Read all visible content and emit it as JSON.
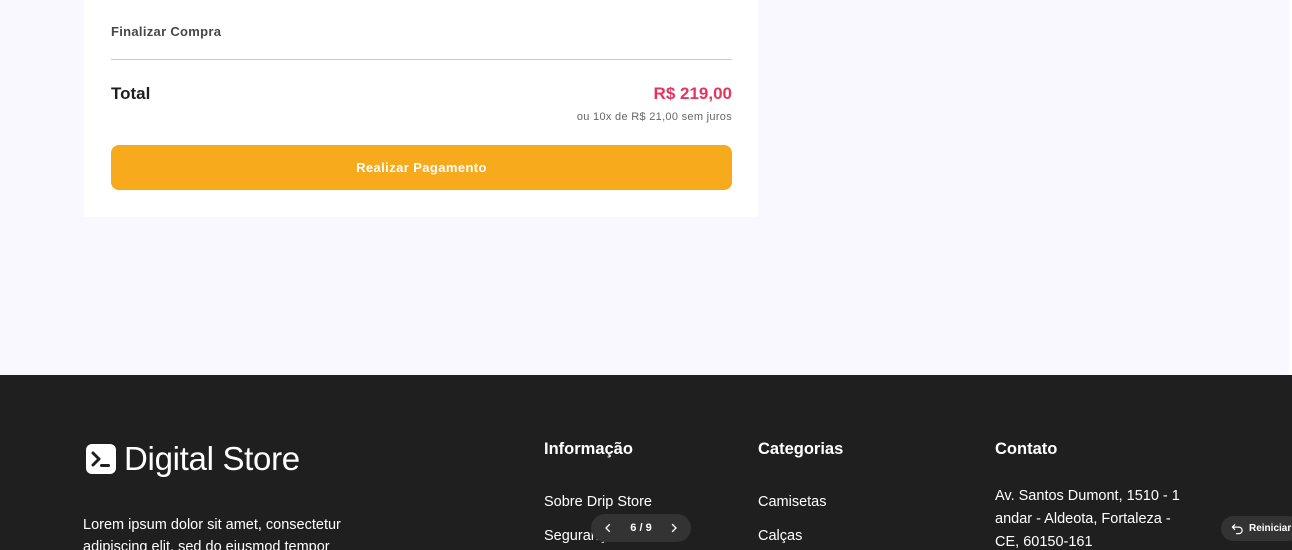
{
  "summary": {
    "section_title": "Finalizar Compra",
    "total_label": "Total",
    "total_value": "R$ 219,00",
    "installments": "ou 10x de R$ 21,00 sem juros",
    "pay_button_label": "Realizar Pagamento"
  },
  "footer": {
    "brand_name": "Digital Store",
    "brand_icon": "terminal-icon",
    "description": "Lorem ipsum dolor sit amet, consectetur adipiscing elit, sed do eiusmod tempor",
    "columns": {
      "info": {
        "title": "Informação",
        "links": [
          "Sobre Drip Store",
          "Segurança"
        ]
      },
      "categories": {
        "title": "Categorias",
        "links": [
          "Camisetas",
          "Calças"
        ]
      },
      "contact": {
        "title": "Contato",
        "address": "Av. Santos Dumont, 1510 - 1 andar - Aldeota, Fortaleza - CE, 60150-161"
      }
    }
  },
  "overlay": {
    "pager": {
      "text": "6 / 9",
      "prev_icon": "chevron-left-icon",
      "next_icon": "chevron-right-icon"
    },
    "reset": {
      "label": "Reiniciar",
      "icon": "undo-icon"
    }
  },
  "colors": {
    "page_background": "#f9f8fe",
    "footer_background": "#1f1f1f",
    "total_price": "#e6335f",
    "pay_button": "#f6aa1c"
  }
}
